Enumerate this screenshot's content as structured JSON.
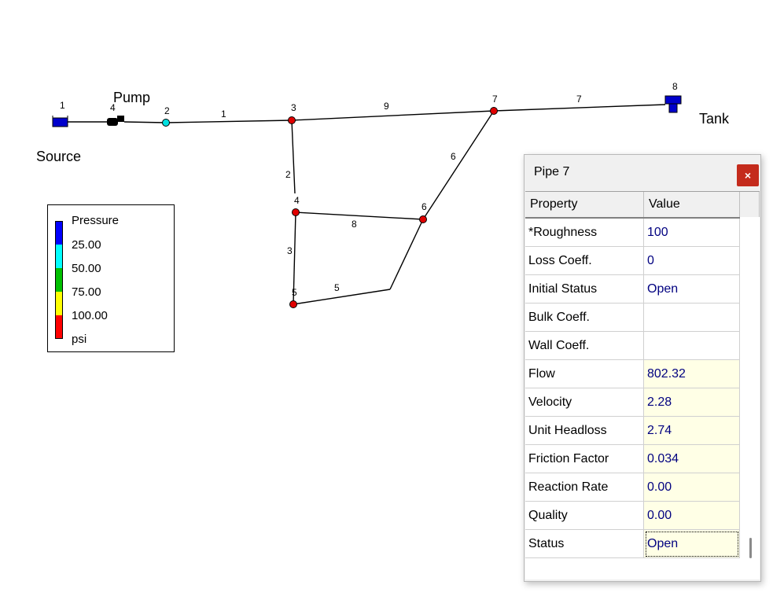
{
  "map": {
    "labels": {
      "pump": "Pump",
      "source": "Source",
      "tank": "Tank"
    },
    "nodes": [
      {
        "id": "1"
      },
      {
        "id": "4"
      },
      {
        "id": "2"
      },
      {
        "id": "3"
      },
      {
        "id": "7"
      },
      {
        "id": "8"
      },
      {
        "id": "4"
      },
      {
        "id": "6"
      },
      {
        "id": "5"
      }
    ],
    "links": [
      {
        "id": "1"
      },
      {
        "id": "9"
      },
      {
        "id": "7"
      },
      {
        "id": "2"
      },
      {
        "id": "8"
      },
      {
        "id": "6"
      },
      {
        "id": "3"
      },
      {
        "id": "5"
      }
    ],
    "colors": {
      "junction_red": "#e00000",
      "junction_cyan": "#00e0e0",
      "reservoir": "#0000cc",
      "tank": "#0000cc"
    }
  },
  "legend": {
    "title": "Pressure",
    "levels": [
      "25.00",
      "50.00",
      "75.00",
      "100.00"
    ],
    "unit": "psi",
    "colors": [
      "#0000ff",
      "#00ffff",
      "#00c000",
      "#ffff00",
      "#ff0000"
    ]
  },
  "property_window": {
    "title": "Pipe 7",
    "close_label": "×",
    "header": {
      "property": "Property",
      "value": "Value"
    },
    "rows": [
      {
        "name": "*Roughness",
        "value": "100",
        "readonly": false
      },
      {
        "name": "Loss Coeff.",
        "value": "0",
        "readonly": false
      },
      {
        "name": "Initial Status",
        "value": "Open",
        "readonly": false
      },
      {
        "name": "Bulk Coeff.",
        "value": "",
        "readonly": false
      },
      {
        "name": "Wall Coeff.",
        "value": "",
        "readonly": false
      },
      {
        "name": "Flow",
        "value": "802.32",
        "readonly": true
      },
      {
        "name": "Velocity",
        "value": "2.28",
        "readonly": true
      },
      {
        "name": "Unit Headloss",
        "value": "2.74",
        "readonly": true
      },
      {
        "name": "Friction Factor",
        "value": "0.034",
        "readonly": true
      },
      {
        "name": "Reaction Rate",
        "value": "0.00",
        "readonly": true
      },
      {
        "name": "Quality",
        "value": "0.00",
        "readonly": true
      },
      {
        "name": "Status",
        "value": "Open",
        "readonly": true,
        "selected": true
      }
    ]
  }
}
